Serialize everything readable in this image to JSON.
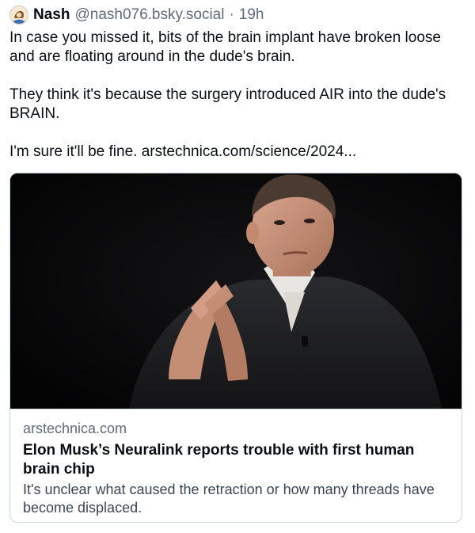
{
  "post": {
    "author_name": "Nash",
    "handle": "@nash076.bsky.social",
    "separator": "·",
    "time": "19h",
    "avatar_icon": "cartoon-avatar-icon",
    "paragraphs": [
      "In case you missed it, bits of the brain implant have broken loose and are floating around in the dude's brain.",
      "They think it's because the surgery introduced AIR into the dude's BRAIN.",
      "I'm sure it'll be fine. "
    ],
    "inline_link": "arstechnica.com/science/2024..."
  },
  "card": {
    "domain": "arstechnica.com",
    "title": "Elon Musk’s Neuralink reports trouble with first human brain chip",
    "description": "It's unclear what caused the retraction or how many threads have become displaced.",
    "border_color": "#c9d3df"
  },
  "colors": {
    "text": "#0b0f14",
    "muted": "#5f6b7a"
  }
}
